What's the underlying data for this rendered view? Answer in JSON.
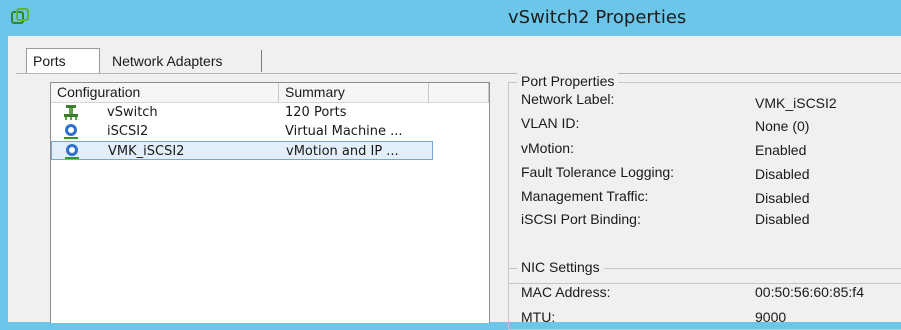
{
  "window": {
    "title": "vSwitch2 Properties",
    "icon": "vmware-logo-icon"
  },
  "tabs": [
    {
      "label": "Ports",
      "active": true
    },
    {
      "label": "Network Adapters",
      "active": false
    }
  ],
  "list": {
    "columns": [
      "Configuration",
      "Summary",
      ""
    ],
    "rows": [
      {
        "icon": "vswitch-icon",
        "name": "vSwitch",
        "summary": "120 Ports",
        "selected": false
      },
      {
        "icon": "port-group-icon",
        "name": "iSCSI2",
        "summary": "Virtual Machine ...",
        "selected": false
      },
      {
        "icon": "vmkernel-port-icon",
        "name": "VMK_iSCSI2",
        "summary": "vMotion and IP ...",
        "selected": true
      }
    ]
  },
  "port_properties": {
    "legend": "Port Properties",
    "items": [
      {
        "label": "Network Label:",
        "value": "VMK_iSCSI2"
      },
      {
        "label": "VLAN ID:",
        "value": "None (0)"
      },
      {
        "label": "vMotion:",
        "value": "Enabled"
      },
      {
        "label": "Fault Tolerance Logging:",
        "value": "Disabled"
      },
      {
        "label": "Management Traffic:",
        "value": "Disabled"
      },
      {
        "label": "iSCSI Port Binding:",
        "value": "Disabled"
      }
    ]
  },
  "nic_settings": {
    "legend": "NIC Settings",
    "items": [
      {
        "label": "MAC Address:",
        "value": "00:50:56:60:85:f4"
      },
      {
        "label": "MTU:",
        "value": "9000"
      }
    ]
  },
  "colors": {
    "titlebar": "#6cc6ea",
    "selection": "#e3eefb"
  }
}
